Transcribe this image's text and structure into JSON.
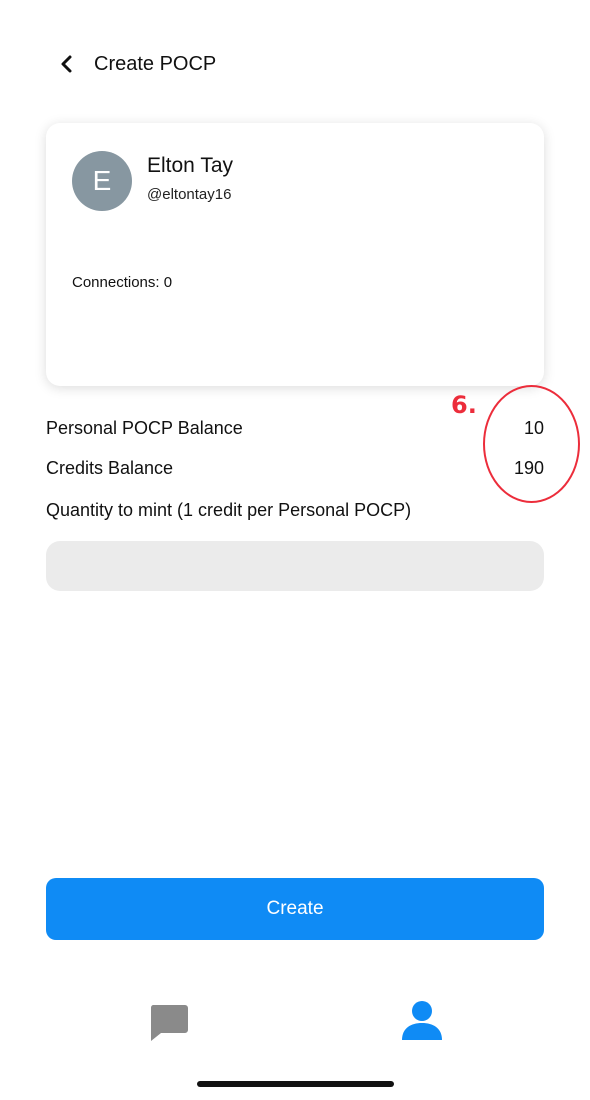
{
  "header": {
    "title": "Create POCP",
    "back_icon": "chevron-left-icon"
  },
  "profile": {
    "avatar_letter": "E",
    "avatar_color": "#8797a1",
    "name": "Elton Tay",
    "handle": "@eltontay16",
    "connections": "Connections: 0"
  },
  "balances": {
    "pocp_label": "Personal POCP Balance",
    "pocp_value": "10",
    "credits_label": "Credits Balance",
    "credits_value": "190"
  },
  "quantity": {
    "label": "Quantity to mint (1 credit per Personal POCP)",
    "value": ""
  },
  "annotation": {
    "label": "6.",
    "color": "#ec2d3b"
  },
  "create_button": {
    "label": "Create",
    "color": "#0f8bf5"
  },
  "tab_bar": {
    "items": [
      {
        "icon": "chat-bubble-icon",
        "active": false,
        "color": "#8a8a8a"
      },
      {
        "icon": "user-icon",
        "active": true,
        "color": "#0f8bf5"
      }
    ]
  }
}
